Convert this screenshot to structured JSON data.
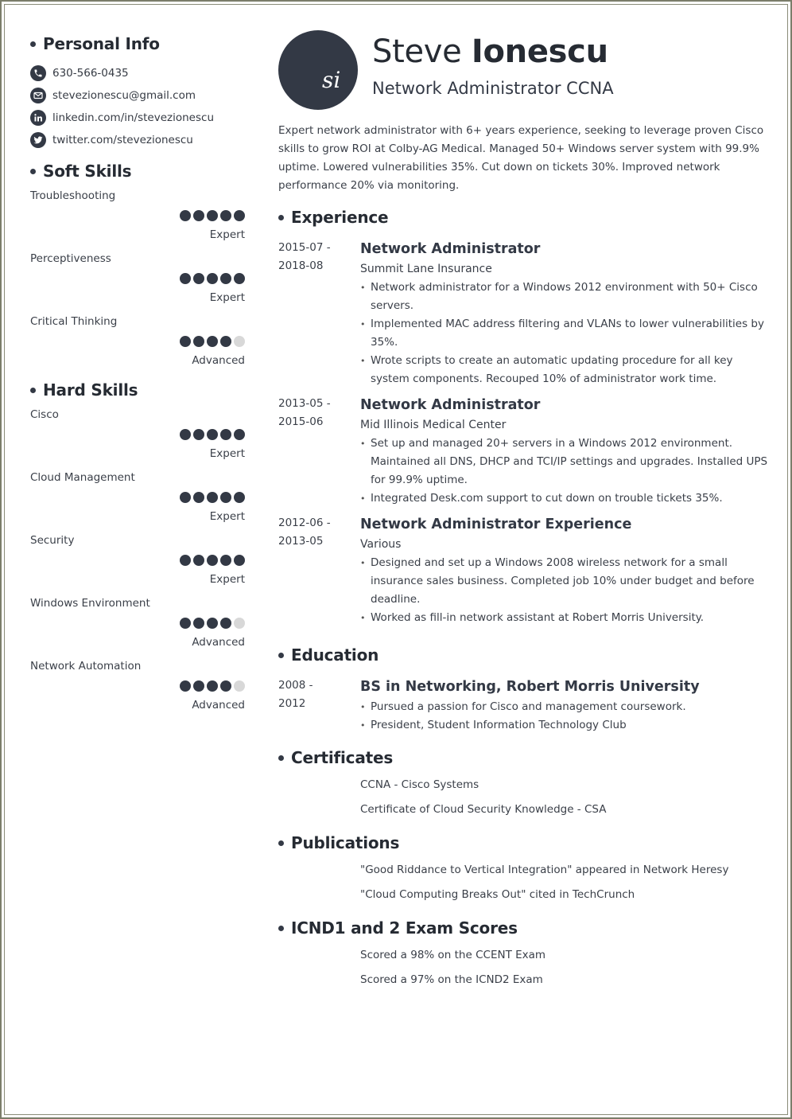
{
  "colors": {
    "accent": "#333945",
    "dot_off": "#d8d8d8",
    "frame": "#7b7d6a"
  },
  "header": {
    "initials": "si",
    "first_name": "Steve",
    "last_name": "Ionescu",
    "title": "Network Administrator CCNA"
  },
  "summary": "Expert network administrator with 6+ years experience, seeking to leverage proven Cisco skills to grow ROI at Colby-AG Medical. Managed 50+ Windows server system with 99.9% uptime. Lowered vulnerabilities 35%. Cut down on tickets 30%. Improved network performance 20% via monitoring.",
  "personal_info": {
    "heading": "Personal Info",
    "items": [
      {
        "icon": "phone-icon",
        "text": "630-566-0435"
      },
      {
        "icon": "email-icon",
        "text": "stevezionescu@gmail.com"
      },
      {
        "icon": "linkedin-icon",
        "text": "linkedin.com/in/stevezionescu"
      },
      {
        "icon": "twitter-icon",
        "text": "twitter.com/stevezionescu"
      }
    ]
  },
  "soft_skills": {
    "heading": "Soft Skills",
    "items": [
      {
        "name": "Troubleshooting",
        "rating": 5,
        "max": 5,
        "level": "Expert"
      },
      {
        "name": "Perceptiveness",
        "rating": 5,
        "max": 5,
        "level": "Expert"
      },
      {
        "name": "Critical Thinking",
        "rating": 4,
        "max": 5,
        "level": "Advanced"
      }
    ]
  },
  "hard_skills": {
    "heading": "Hard Skills",
    "items": [
      {
        "name": "Cisco",
        "rating": 5,
        "max": 5,
        "level": "Expert"
      },
      {
        "name": "Cloud Management",
        "rating": 5,
        "max": 5,
        "level": "Expert"
      },
      {
        "name": "Security",
        "rating": 5,
        "max": 5,
        "level": "Expert"
      },
      {
        "name": "Windows Environment",
        "rating": 4,
        "max": 5,
        "level": "Advanced"
      },
      {
        "name": "Network Automation",
        "rating": 4,
        "max": 5,
        "level": "Advanced"
      }
    ]
  },
  "experience": {
    "heading": "Experience",
    "items": [
      {
        "date_start": "2015-07 -",
        "date_end": "2018-08",
        "title": "Network Administrator",
        "org": "Summit Lane Insurance",
        "bullets": [
          "Network administrator for a Windows 2012  environment with 50+ Cisco servers.",
          "Implemented MAC address filtering and VLANs to lower vulnerabilities by 35%.",
          "Wrote scripts to create an automatic updating procedure for all key system components. Recouped 10% of administrator work time."
        ]
      },
      {
        "date_start": "2013-05 -",
        "date_end": "2015-06",
        "title": "Network Administrator",
        "org": "Mid Illinois Medical Center",
        "bullets": [
          "Set up and managed 20+ servers in a Windows 2012 environment. Maintained all DNS, DHCP and TCI/IP settings and upgrades. Installed UPS for 99.9% uptime.",
          "Integrated Desk.com support to cut down on trouble tickets 35%."
        ]
      },
      {
        "date_start": "2012-06 -",
        "date_end": "2013-05",
        "title": "Network Administrator Experience",
        "org": "Various",
        "bullets": [
          "Designed and set up a Windows 2008 wireless network for a small insurance sales business. Completed job 10% under budget and before deadline.",
          "Worked as fill-in network assistant at Robert Morris University."
        ]
      }
    ]
  },
  "education": {
    "heading": "Education",
    "items": [
      {
        "date_start": "2008 -",
        "date_end": "2012",
        "title": "BS in Networking, Robert Morris University",
        "bullets": [
          "Pursued a passion for Cisco and management coursework.",
          "President, Student Information Technology Club"
        ]
      }
    ]
  },
  "certificates": {
    "heading": "Certificates",
    "items": [
      "CCNA - Cisco Systems",
      "Certificate of Cloud Security Knowledge - CSA"
    ]
  },
  "publications": {
    "heading": "Publications",
    "items": [
      "\"Good Riddance to Vertical Integration\" appeared in Network Heresy",
      "\"Cloud Computing Breaks Out\" cited in TechCrunch"
    ]
  },
  "exam_scores": {
    "heading": "ICND1 and 2 Exam Scores",
    "items": [
      "Scored a 98% on the CCENT Exam",
      "Scored a 97% on the ICND2 Exam"
    ]
  }
}
